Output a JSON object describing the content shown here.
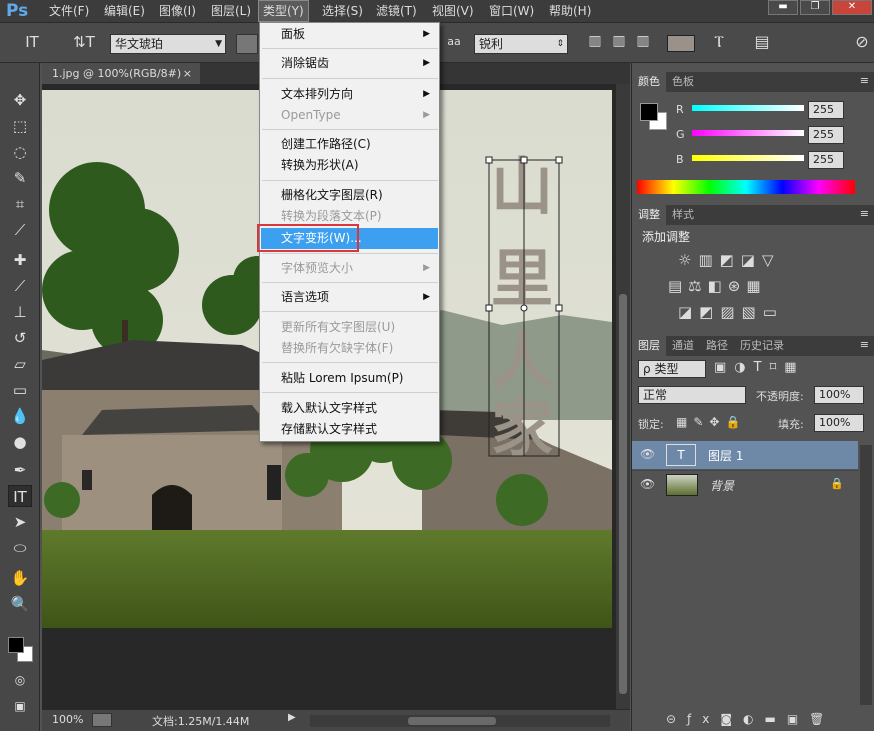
{
  "app": {
    "logo": "Ps"
  },
  "menubar": {
    "items": [
      "文件(F)",
      "编辑(E)",
      "图像(I)",
      "图层(L)",
      "类型(Y)",
      "选择(S)",
      "滤镜(T)",
      "视图(V)",
      "窗口(W)",
      "帮助(H)"
    ],
    "active": "类型(Y)"
  },
  "window_controls": {
    "minimize": "▬",
    "restore": "❐",
    "close": "✕"
  },
  "options_bar": {
    "font_family": "华文琥珀",
    "aa_label": "aa",
    "antialias": "锐利",
    "swatch_color": "#9a918a"
  },
  "document_tab": {
    "title": "1.jpg @ 100%(RGB/8#)",
    "close": "×"
  },
  "type_menu": [
    {
      "label": "面板",
      "submenu": true,
      "disabled": false
    },
    {
      "label": "消除锯齿",
      "submenu": true,
      "disabled": false
    },
    {
      "label": "文本排列方向",
      "submenu": true,
      "disabled": false
    },
    {
      "label": "OpenType",
      "submenu": true,
      "disabled": true
    },
    {
      "label": "创建工作路径(C)",
      "submenu": false,
      "disabled": false
    },
    {
      "label": "转换为形状(A)",
      "submenu": false,
      "disabled": false
    },
    {
      "label": "栅格化文字图层(R)",
      "submenu": false,
      "disabled": false
    },
    {
      "label": "转换为段落文本(P)",
      "submenu": false,
      "disabled": true
    },
    {
      "label": "文字变形(W)...",
      "submenu": false,
      "disabled": false,
      "highlighted": true
    },
    {
      "label": "字体预览大小",
      "submenu": true,
      "disabled": true
    },
    {
      "label": "语言选项",
      "submenu": true,
      "disabled": false
    },
    {
      "label": "更新所有文字图层(U)",
      "submenu": false,
      "disabled": true
    },
    {
      "label": "替换所有欠缺字体(F)",
      "submenu": false,
      "disabled": true
    },
    {
      "label": "粘贴 Lorem Ipsum(P)",
      "submenu": false,
      "disabled": false
    },
    {
      "label": "载入默认文字样式",
      "submenu": false,
      "disabled": false
    },
    {
      "label": "存储默认文字样式",
      "submenu": false,
      "disabled": false
    }
  ],
  "canvas_text": [
    "山",
    "里",
    "人",
    "家"
  ],
  "status_bar": {
    "zoom": "100%",
    "doc_info": "文档:1.25M/1.44M"
  },
  "color_panel": {
    "tabs": [
      "颜色",
      "色板"
    ],
    "channels": [
      {
        "label": "R",
        "value": "255",
        "gradient": "#00ffff"
      },
      {
        "label": "G",
        "value": "255",
        "gradient": "#ff00ff"
      },
      {
        "label": "B",
        "value": "255",
        "gradient": "#ffff00"
      }
    ]
  },
  "adjust_panel": {
    "tabs": [
      "调整",
      "样式"
    ],
    "title": "添加调整"
  },
  "layers_panel": {
    "tabs": [
      "图层",
      "通道",
      "路径",
      "历史记录"
    ],
    "filter": "类型",
    "blend_mode": "正常",
    "opacity_label": "不透明度:",
    "opacity": "100%",
    "lock_label": "锁定:",
    "fill_label": "填充:",
    "fill": "100%",
    "layers": [
      {
        "name": "图层 1",
        "thumb": "T",
        "selected": true
      },
      {
        "name": "背景",
        "thumb": "",
        "selected": false,
        "locked": true
      }
    ]
  }
}
